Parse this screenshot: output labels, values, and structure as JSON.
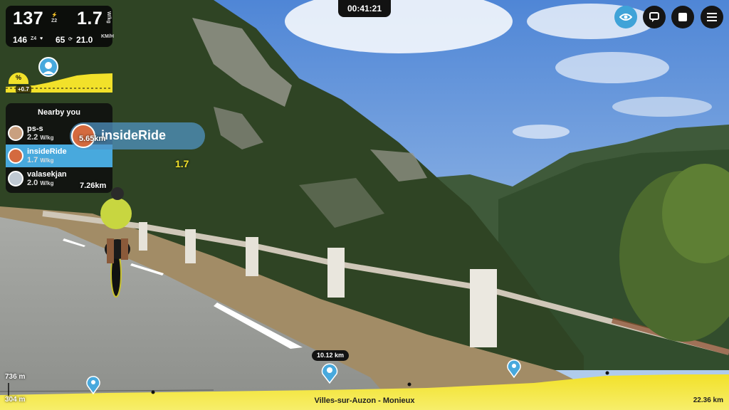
{
  "ride": {
    "elapsed_time": "00:41:21"
  },
  "stats": {
    "power": "137",
    "power_zone": "Z2",
    "wkg": "1.7",
    "wkg_unit": "W/kg",
    "heart_rate": "146",
    "hr_zone": "Z4",
    "cadence": "65",
    "speed": "21.0",
    "speed_unit": "KM/H"
  },
  "grade": {
    "label": "%",
    "value": "+0.7"
  },
  "nearby": {
    "title": "Nearby you",
    "riders": [
      {
        "name": "ps-s",
        "value": "2.2",
        "unit": "W/kg",
        "is_me": false
      },
      {
        "name": "insideRide",
        "value": "1.7",
        "unit": "W/kg",
        "is_me": true
      },
      {
        "name": "valasekjan",
        "value": "2.0",
        "unit": "W/kg",
        "is_me": false
      }
    ]
  },
  "rider_tag": {
    "name": "insideRide",
    "wkg": "1.7",
    "gap_distance": "5.65km",
    "other_distance": "7.26km"
  },
  "profile": {
    "max_elevation": "736 m",
    "min_elevation": "304 m",
    "current_distance": "10.12 km",
    "route_name": "Villes-sur-Auzon - Monieux",
    "total_distance": "22.36 km"
  },
  "controls": [
    {
      "icon": "eye-icon",
      "active": true
    },
    {
      "icon": "chat-icon",
      "active": false
    },
    {
      "icon": "stop-icon",
      "active": false
    },
    {
      "icon": "menu-icon",
      "active": false
    }
  ],
  "colors": {
    "accent": "#48a9dd",
    "profile_yellow": "#f2e12a",
    "panel_dark": "#121212"
  }
}
